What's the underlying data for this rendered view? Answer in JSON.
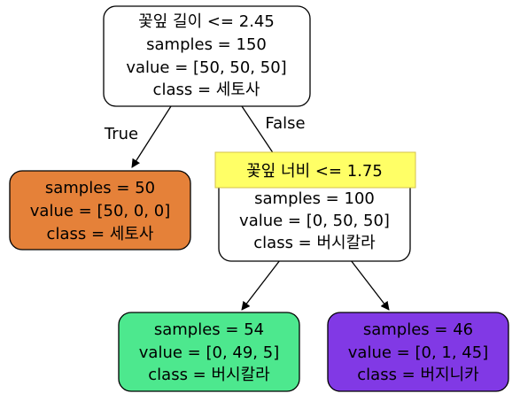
{
  "tree": {
    "root": {
      "lines": [
        "꽃잎 길이 <= 2.45",
        "samples = 150",
        "value = [50, 50, 50]",
        "class = 세토사"
      ],
      "fill": "#ffffff"
    },
    "left_leaf": {
      "lines": [
        "samples = 50",
        "value = [50, 0, 0]",
        "class = 세토사"
      ],
      "fill": "#e58139"
    },
    "right_split": {
      "lines": [
        "꽃잎 너비 <= 1.75",
        "samples = 100",
        "value = [0, 50, 50]",
        "class = 버시칼라"
      ],
      "fill": "#ffffff",
      "highlight_color": "#ffff66"
    },
    "leaf_versicolor": {
      "lines": [
        "samples = 54",
        "value = [0, 49, 5]",
        "class = 버시칼라"
      ],
      "fill": "#4de88e"
    },
    "leaf_virginica": {
      "lines": [
        "samples = 46",
        "value = [0, 1, 45]",
        "class = 버지니카"
      ],
      "fill": "#8139e5"
    },
    "edge_labels": {
      "true": "True",
      "false": "False"
    }
  }
}
